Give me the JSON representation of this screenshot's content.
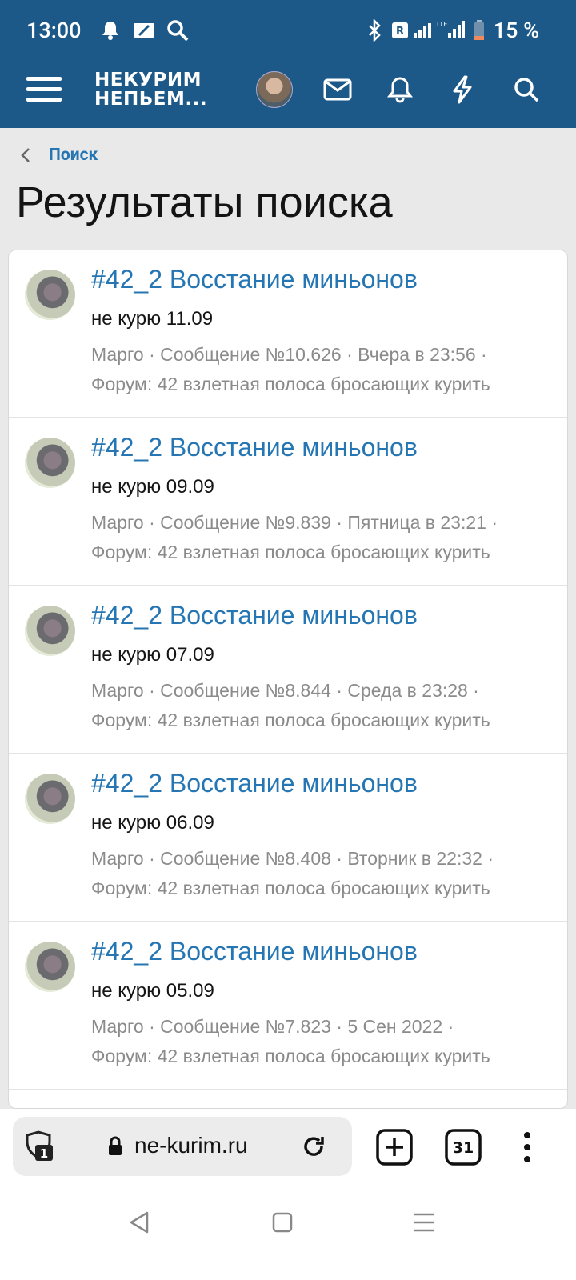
{
  "status_bar": {
    "time": "13:00",
    "battery_percent": "15 %",
    "icons": [
      "bell-icon",
      "sim-card-icon",
      "search-icon",
      "bluetooth-icon",
      "r-badge-icon",
      "signal-icon",
      "lte-signal-icon",
      "battery-icon"
    ]
  },
  "header": {
    "brand_line1": "НЕКУРИМ",
    "brand_line2": "НЕПЬЕМ...",
    "icons": [
      "menu-icon",
      "avatar",
      "mail-icon",
      "bell-icon",
      "lightning-icon",
      "search-icon"
    ]
  },
  "breadcrumb": {
    "label": "Поиск"
  },
  "page": {
    "title": "Результаты поиска"
  },
  "results": [
    {
      "title": "#42_2 Восстание миньонов",
      "snippet": "не курю 11.09",
      "meta_line1": "Марго · Сообщение №10.626 · Вчера в 23:56 ·",
      "meta_line2": "Форум: 42 взлетная полоса бросающих курить"
    },
    {
      "title": "#42_2 Восстание миньонов",
      "snippet": "не курю 09.09",
      "meta_line1": "Марго · Сообщение №9.839 · Пятница в 23:21 ·",
      "meta_line2": "Форум: 42 взлетная полоса бросающих курить"
    },
    {
      "title": "#42_2 Восстание миньонов",
      "snippet": "не курю 07.09",
      "meta_line1": "Марго · Сообщение №8.844 · Среда в 23:28 ·",
      "meta_line2": "Форум: 42 взлетная полоса бросающих курить"
    },
    {
      "title": "#42_2 Восстание миньонов",
      "snippet": "не курю 06.09",
      "meta_line1": "Марго · Сообщение №8.408 · Вторник в 22:32 ·",
      "meta_line2": "Форум: 42 взлетная полоса бросающих курить"
    },
    {
      "title": "#42_2 Восстание миньонов",
      "snippet": "не курю 05.09",
      "meta_line1": "Марго · Сообщение №7.823 · 5 Сен 2022 ·",
      "meta_line2": "Форум: 42 взлетная полоса бросающих курить"
    }
  ],
  "browser": {
    "url": "ne-kurim.ru",
    "private_tabs_count": "1",
    "tabs_count": "31"
  },
  "colors": {
    "header_bg": "#1d5988",
    "link": "#2576b3",
    "meta_text": "#8b8b8b",
    "page_bg": "#e9e9e9"
  }
}
